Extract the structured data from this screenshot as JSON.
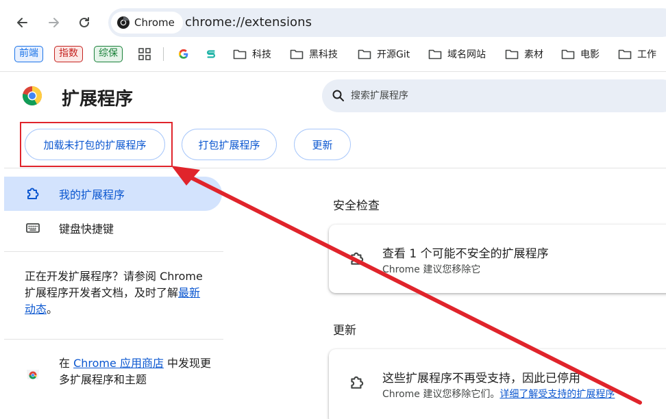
{
  "browser": {
    "site_chip": "Chrome",
    "url": "chrome://extensions"
  },
  "bookmarks": {
    "tags": [
      {
        "label": "前端",
        "color": "#1a73e8",
        "bg": "#e8f0fe"
      },
      {
        "label": "指数",
        "color": "#c5221f",
        "bg": "#fce8e6"
      },
      {
        "label": "综保",
        "color": "#188038",
        "bg": "#e6f4ea"
      }
    ],
    "folders": [
      "科技",
      "黑科技",
      "开源Git",
      "域名网站",
      "素材",
      "电影",
      "工作"
    ]
  },
  "page": {
    "title": "扩展程序",
    "search_placeholder": "搜索扩展程序"
  },
  "actions": {
    "load_unpacked": "加载未打包的扩展程序",
    "pack": "打包扩展程序",
    "update": "更新"
  },
  "sidebar": {
    "items": [
      {
        "label": "我的扩展程序"
      },
      {
        "label": "键盘快捷键"
      }
    ],
    "dev_text_1": "正在开发扩展程序？请参阅 Chrome 扩展程序开发者文档，及时了解",
    "dev_link": "最新动态",
    "dev_text_2": "。",
    "store_text_1": "在 ",
    "store_link": "Chrome 应用商店",
    "store_text_2": " 中发现更多扩展程序和主题"
  },
  "safety": {
    "section": "安全检查",
    "title": "查看 1 个可能不安全的扩展程序",
    "subtitle": "Chrome 建议您移除它"
  },
  "updates": {
    "section": "更新",
    "title": "这些扩展程序不再受支持，因此已停用",
    "subtitle": "Chrome 建议您移除它们。",
    "link": "详细了解受支持的扩展程序"
  },
  "colors": {
    "accent": "#0b57d0",
    "annotation": "#e0242b"
  }
}
